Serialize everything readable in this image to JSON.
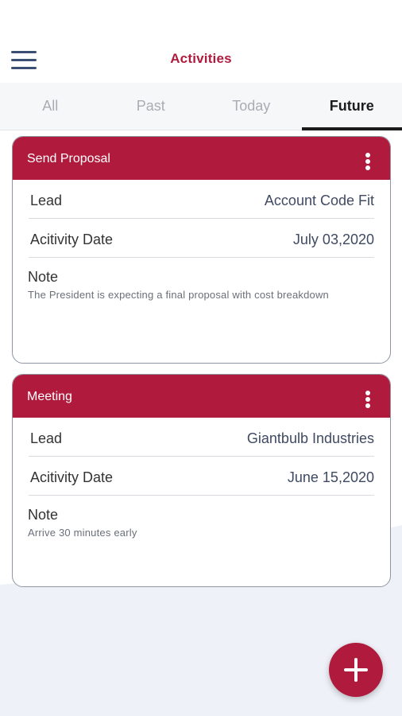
{
  "header": {
    "title": "Activities",
    "menu_icon": "hamburger-menu-icon"
  },
  "tabs": [
    {
      "label": "All",
      "active": false
    },
    {
      "label": "Past",
      "active": false
    },
    {
      "label": "Today",
      "active": false
    },
    {
      "label": "Future",
      "active": true
    }
  ],
  "activities": [
    {
      "title": "Send Proposal",
      "lead_label": "Lead",
      "lead_value": "Account Code Fit",
      "date_label": "Acitivity Date",
      "date_value": "July 03,2020",
      "note_label": "Note",
      "note_text": "The President is expecting a final proposal with cost breakdown"
    },
    {
      "title": "Meeting",
      "lead_label": "Lead",
      "lead_value": "Giantbulb Industries",
      "date_label": "Acitivity Date",
      "date_value": "June 15,2020",
      "note_label": "Note",
      "note_text": "Arrive 30 minutes early"
    }
  ],
  "fab": {
    "icon": "plus-icon"
  },
  "colors": {
    "accent": "#b01b3d",
    "menu_icon": "#3b4f73",
    "tab_inactive": "#a9adb3",
    "background_wave": "#eef2f8"
  }
}
